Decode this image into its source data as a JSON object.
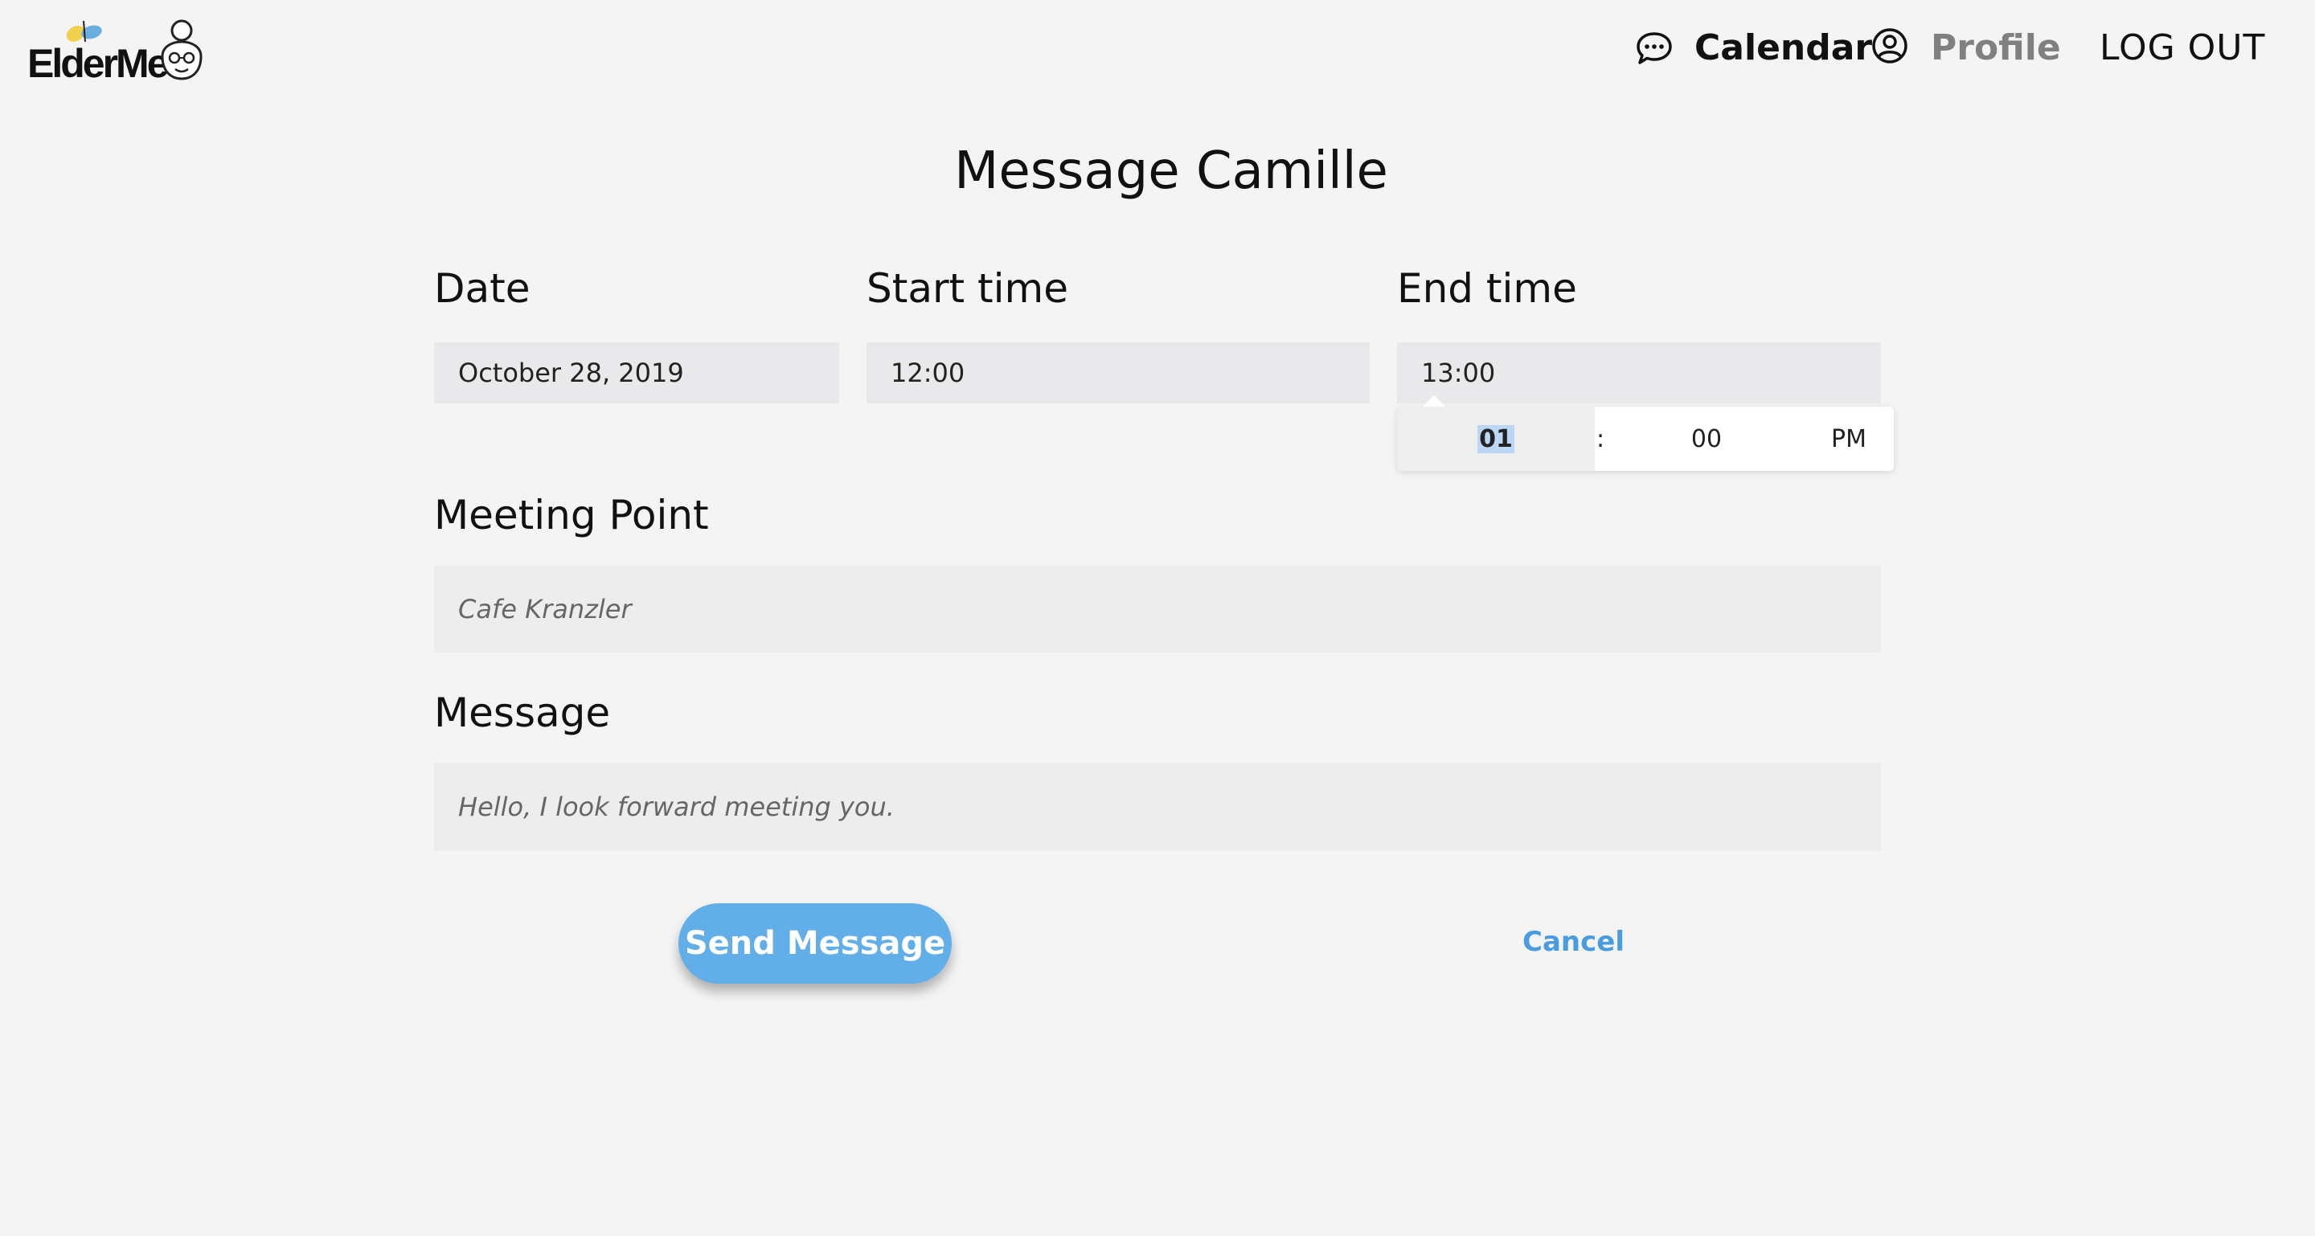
{
  "header": {
    "logo_text": "ElderMe",
    "nav": {
      "calendar_label": "Calendar",
      "profile_label": "Profile",
      "logout_label": "LOG OUT"
    }
  },
  "main": {
    "title": "Message Camille",
    "fields": {
      "date": {
        "label": "Date",
        "value": "October 28, 2019"
      },
      "start_time": {
        "label": "Start time",
        "value": "12:00"
      },
      "end_time": {
        "label": "End time",
        "value": "13:00"
      },
      "meeting_point": {
        "label": "Meeting Point",
        "placeholder": "Cafe Kranzler"
      },
      "message": {
        "label": "Message",
        "placeholder": "Hello, I look forward meeting you."
      }
    },
    "time_picker": {
      "hour": "01",
      "separator": ":",
      "minute": "00",
      "period": "PM"
    },
    "actions": {
      "send_label": "Send Message",
      "cancel_label": "Cancel"
    }
  },
  "colors": {
    "accent": "#62aee8",
    "link": "#4a9be0",
    "background": "#f4f4f4",
    "input_bg": "#e9e9eb"
  },
  "icons": {
    "chat": "chat-bubble-icon",
    "profile": "user-circle-icon"
  }
}
